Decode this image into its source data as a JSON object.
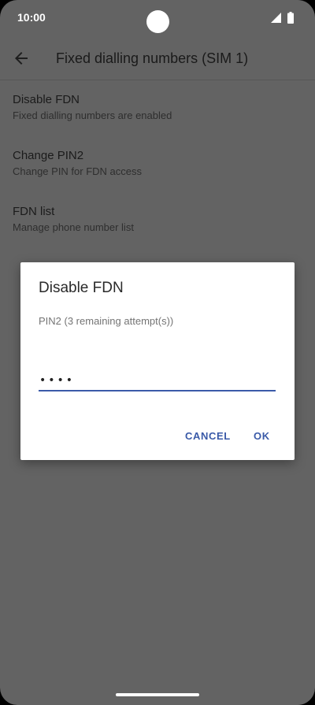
{
  "status_bar": {
    "time": "10:00",
    "icons": [
      "signal-icon",
      "battery-icon"
    ]
  },
  "app_bar": {
    "title": "Fixed dialling numbers (SIM 1)",
    "back_icon": "back-arrow-icon"
  },
  "prefs": [
    {
      "title": "Disable FDN",
      "subtitle": "Fixed dialling numbers are enabled"
    },
    {
      "title": "Change PIN2",
      "subtitle": "Change PIN for FDN access"
    },
    {
      "title": "FDN list",
      "subtitle": "Manage phone number list"
    }
  ],
  "dialog": {
    "title": "Disable FDN",
    "message": "PIN2 (3 remaining attempt(s))",
    "pin_value": "••••",
    "cancel_label": "CANCEL",
    "ok_label": "OK"
  },
  "colors": {
    "scrim_background": "#636363",
    "dialog_background": "#ffffff",
    "accent": "#3a5aa8"
  }
}
